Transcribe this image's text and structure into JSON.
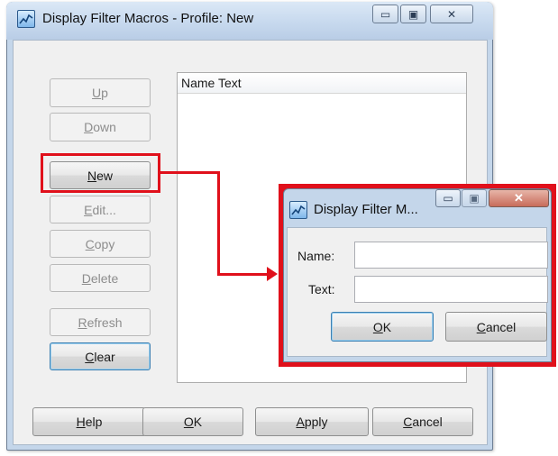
{
  "main_window": {
    "title": "Display Filter Macros - Profile: New",
    "caption_buttons": {
      "minimize": "▭",
      "maximize": "▣",
      "close": "✕"
    },
    "side_buttons": [
      {
        "label": "Up",
        "mnemonic": "U",
        "rest": "p",
        "enabled": false
      },
      {
        "label": "Down",
        "mnemonic": "D",
        "rest": "own",
        "enabled": false
      },
      {
        "label": "New",
        "mnemonic": "N",
        "rest": "ew",
        "enabled": true
      },
      {
        "label": "Edit...",
        "mnemonic": "E",
        "rest": "dit...",
        "enabled": false
      },
      {
        "label": "Copy",
        "mnemonic": "C",
        "rest": "opy",
        "enabled": false
      },
      {
        "label": "Delete",
        "mnemonic": "D",
        "rest": "elete",
        "enabled": false
      },
      {
        "label": "Refresh",
        "mnemonic": "R",
        "rest": "efresh",
        "enabled": false
      },
      {
        "label": "Clear",
        "mnemonic": "C",
        "rest": "lear",
        "enabled": true
      }
    ],
    "list_header": "Name Text",
    "bottom_buttons": [
      {
        "label": "Help",
        "mnemonic": "H",
        "rest": "elp"
      },
      {
        "label": "OK",
        "mnemonic": "O",
        "rest": "K"
      },
      {
        "label": "Apply",
        "mnemonic": "A",
        "rest": "pply"
      },
      {
        "label": "Cancel",
        "mnemonic": "C",
        "rest": "ancel"
      }
    ]
  },
  "sub_dialog": {
    "title": "Display Filter M...",
    "caption_buttons": {
      "minimize": "▭",
      "maximize": "▣",
      "close": "✕"
    },
    "name_label": "Name:",
    "text_label": "Text:",
    "name_value": "",
    "text_value": "",
    "ok": {
      "mnemonic": "O",
      "rest": "K"
    },
    "cancel": {
      "mnemonic": "C",
      "rest": "ancel"
    }
  },
  "colors": {
    "highlight": "#e0101b",
    "title_bar": "#c4d6ea"
  }
}
